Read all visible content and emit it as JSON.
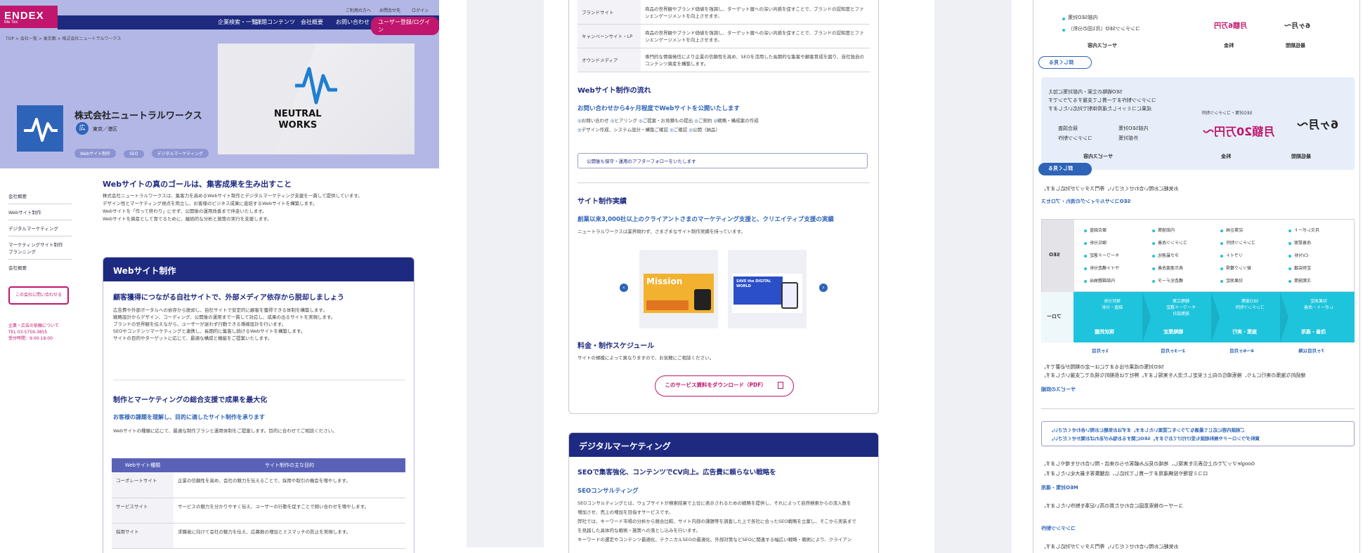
{
  "panel1": {
    "logo": {
      "main": "ENDEX",
      "sub": "Me  Tex"
    },
    "utility": [
      "ご利用の方へ",
      "お問合せ先",
      "ログイン"
    ],
    "nav": [
      "企業検索・一覧",
      "課題コンテンツ",
      "会社概要",
      "お問い合わせ"
    ],
    "nav_cta": "ユーザー登録/ログイン",
    "breadcrumb": "TOP  >  会社一覧  >  東京都  >  株式会社ニュートラルワークス",
    "hero_image_text": [
      "NEUTRAL",
      "WORKS"
    ],
    "company": {
      "name": "株式会社ニュートラルワークス",
      "badge": "広",
      "location": "東京／港区"
    },
    "tags": [
      "Webサイト制作",
      "SEO",
      "デジタルマーケティング"
    ],
    "sidebar": [
      "会社概要",
      "Webサイト制作",
      "デジタルマーケティング",
      "マーケティングサイト制作\nプランニング",
      "会社概要"
    ],
    "sidebar_cta": "この会社に問い合わせる",
    "sidebar_contact": [
      "企業・広告の依頼について",
      "TEL 03-5759-3855",
      "受付時間：9:00-18:00"
    ],
    "main_heading": "Webサイトの真のゴールは、集客成果を生み出すこと",
    "intro": [
      "株式会社ニュートラルワークスは、集客力を高めるWebサイト制作とデジタルマーケティング支援を一貫して提供しています。",
      "デザイン性とマーケティング視点を両立し、お客様のビジネス成果に直結するWebサイトを構築します。",
      "Webサイトを「作って終わり」にせず、公開後の運用改善まで伴走いたします。",
      "Webサイトを資産として育てるために、継続的な分析と施策の実行を支援します。"
    ],
    "service": {
      "title": "Webサイト制作",
      "heading1": "顧客獲得につながる自社サイトで、外部メディア依存から脱却しましょう",
      "para1": [
        "広告費や外部ポータルへの依存から脱却し、自社サイトで安定的に顧客を獲得できる体制を構築します。",
        "戦略設計からデザイン、コーディング、公開後の運用まで一貫して対応し、成果の出るサイトを実現します。",
        "ブランドの世界観を伝えながら、ユーザーが迷わず行動できる導線設計を行います。",
        "SEOやコンテンツマーケティングと連携し、長期的に集客し続けるWebサイトを構築します。",
        "サイトの目的やターゲットに応じて、最適な構成と機能をご提案いたします。"
      ],
      "heading2": "制作とマーケティングの総合支援で成果を最大化",
      "sub2": "お客様の課題を理解し、目的に適したサイト制作を承ります",
      "para2": "Webサイトの種類に応じて、最適な制作プランと運用体制をご提案します。目的に合わせてご相談ください。",
      "table_head": [
        "Webサイト種類",
        "サイト制作の主な目的"
      ],
      "table_rows": [
        {
          "k": "コーポレートサイト",
          "v": "企業の信頼性を高め、会社の魅力を伝えることで、採用や取引の機会を増やします。"
        },
        {
          "k": "サービスサイト",
          "v": "サービスの魅力を分かりやすく伝え、ユーザーの行動を促すことで問い合わせを増やします。"
        },
        {
          "k": "採用サイト",
          "v": "求職者に向けて会社の魅力を伝え、応募数の増加とミスマッチの防止を実現します。"
        }
      ]
    }
  },
  "panel2": {
    "table_rows": [
      {
        "k": "ブランドサイト",
        "v": "商品の世界観やブランド価値を強調し、ターゲット層への深い共感を促すことで、ブランドの認知度とファンエンゲージメントを向上させます。"
      },
      {
        "k": "キャンペーンサイト・LP",
        "v": "商品の世界観やブランド価値を強調し、ターゲット層への深い共感を促すことで、ブランドの認知度とファンエンゲージメントを向上させます。"
      },
      {
        "k": "オウンドメディア",
        "v": "専門的な情報発信により企業の信頼性を高め、SEOを活用した長期的な集客や顧客育成を図り、自社独自のコンテンツ資産を構築します。"
      }
    ],
    "flow_title": "Webサイト制作の流れ",
    "flow_sub": "お問い合わせから4ヶ月程度でWebサイトを公開いたします",
    "flow_steps_1": [
      "お問い合わせ",
      "ヒアリング",
      "ご提案・お見積もの提出",
      "ご契約",
      "戦略・構成案の作成"
    ],
    "flow_steps_2": [
      "デザイン作成、システム設計・構築ご確認",
      "ご確認",
      "公開（納品）"
    ],
    "flow_note": "公開後も保守・運用のアフターフォローをいたします",
    "works_title": "サイト制作実績",
    "works_sub": "創業以来3,000社以上のクライアントさまのマーケティング支援と、クリエイティブ支援の実績",
    "works_p": "ニュートラルワークスは業界問わず、さまざまなサイト制作実績を持っています。",
    "thumb1": "Mission",
    "thumb2": "SAVE the DIGITAL WORLD",
    "prev": "‹",
    "next": "›",
    "price_title": "料金・制作スケジュール",
    "price_p": "サイトの規模によって異なりますので、お気軽にご相談ください。",
    "download": "このサービス資料をダウンロード（PDF）",
    "dm_title": "デジタルマーケティング",
    "dm_h": "SEOで集客強化、コンテンツでCV向上。広告費に頼らない戦略を",
    "dm_sub": "SEOコンサルティング",
    "dm_p": [
      "SEOコンサルティングとは、ウェブサイトが検索結果で上位に表示されるための戦略を提供し、それによって自然検索からの流入数を",
      "増加させ、売上の増加を目指すサービスです。",
      "弊社では、キーワード市場の分析から競合比較、サイト内部の課題等を調査した上で各社に合ったSEO戦略を立案し、そこから実装まで",
      "を見越した具体的な戦術・施策への落とし込みを行います。",
      "キーワードの選定やコンテンツ最適化、テクニカルSEOの最適化、外部対策などSEOに関連する幅広い戦略・戦術により、クライアン"
    ]
  },
  "panel3": {
    "top_items": [
      "内部SEO対策",
      "コンテンツSEO（月1回の分析）"
    ],
    "top_price": "月額6万円",
    "top_term": "6ヶ月〜",
    "col_labels": [
      "サービス内容",
      "料金",
      "最低期間"
    ],
    "pill1": "詳しく見る",
    "plan_lines": [
      "SEO戦略の立案・内部対策に加え",
      "コンテンツ制作まで一貫して支援するプランです",
      "成果にコミットした運用体制で対応いたします"
    ],
    "plan_tag": "SEO対策・コンテンツ制作",
    "plan_price": "月額20万円〜",
    "plan_term": "6ヶ月〜",
    "plan_items": [
      "競合調査",
      "内部SEO対策",
      "コンテンツ制作",
      "外部対策",
      "レポート作成"
    ],
    "pill2": "詳しく見る",
    "after_pill": "お気軽にお問い合わせください。専門スタッフが対応します。",
    "seo_process": "SEOコンサルティングの流れ・プロセス",
    "seo_label": "SEO",
    "seo_cols": [
      [
        "競合調査",
        "順位分析",
        "キーワード選定",
        "サイト構造分析",
        "内部課題抽出"
      ],
      [
        "内部施策",
        "コンテンツ改善",
        "タグ最適化",
        "表示速度改善",
        "構造化データ"
      ],
      [
        "記事企画",
        "コンテンツ制作",
        "リライト",
        "被リンク獲得",
        "効果測定"
      ],
      [
        "月次レポート",
        "改善提案",
        "CV分析",
        "定例会議",
        "次期施策"
      ]
    ],
    "flow_label": "フロー",
    "flow_steps": [
      {
        "top": "現状分析\n調査・分析",
        "bottom": "現状把握"
      },
      {
        "top": "戦略立案\nキーワード選定\n施策設計",
        "bottom": "戦略策定"
      },
      {
        "top": "SEO施策\nコンテンツ制作",
        "bottom": "施策・実行"
      },
      {
        "top": "効果測定\nレポート・改善",
        "bottom": "改善・運用"
      }
    ],
    "flow_periods": [
      "1ヶ月目",
      "2〜3ヶ月目",
      "4〜6ヶ月目",
      "7ヶ月目以降"
    ],
    "p_lines": [
      "SEO対策の成果が出るまでには一定の期間が必要です。",
      "継続的な施策の実行により、検索順位の向上と安定した流入を実現します。弊社では長期的な視点でご支援いたします。"
    ],
    "sub_link": "サービスの詳細",
    "box2_lines": [
      "ご相談内容に応じて最適なプランをご提案いたします。まずはお気軽にお問い合わせください。",
      "資料ダウンロードや無料相談も受け付けております。SEOに関するお悩みがあればお聞かせください。"
    ],
    "meo_title": "MEO対策・運用",
    "meo_p": [
      "Googleマップでの上位表示を実現し、地域の見込み顧客からの来店・問い合わせを増やします。",
      "口コミ管理や投稿運用まで一貫して対応し、店舗集客を最大化いたします。"
    ],
    "content_title": "コンテンツ制作",
    "content_p": "ユーザーの検索意図に合わせた質の高い記事を制作いたします。"
  },
  "colors": {
    "navy": "#1e2a80",
    "magenta": "#c0166d",
    "blue": "#2e64b8",
    "cyan": "#1ec4dc",
    "hero": "#b3b7e6"
  }
}
